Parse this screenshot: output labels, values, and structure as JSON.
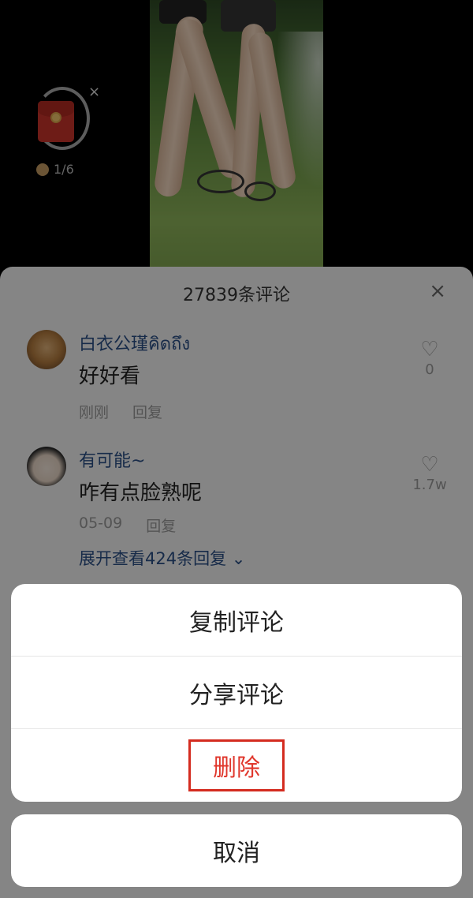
{
  "reward": {
    "progress": "1/6",
    "close_glyph": "×"
  },
  "comments": {
    "title": "27839条评论",
    "close_glyph": "×",
    "items": [
      {
        "name": "白衣公瑾คิดถึง",
        "text": "好好看",
        "time": "刚刚",
        "reply": "回复",
        "likes": "0"
      },
      {
        "name": "有可能~",
        "text": "咋有点脸熟呢",
        "time": "05-09",
        "reply": "回复",
        "likes": "1.7w",
        "expand": "展开查看424条回复 ⌄"
      }
    ]
  },
  "action_sheet": {
    "copy": "复制评论",
    "share": "分享评论",
    "delete": "删除",
    "cancel": "取消"
  },
  "colors": {
    "link_blue": "#2b4f86",
    "delete_red": "#e0372c",
    "highlight_box": "#d42b1f"
  }
}
